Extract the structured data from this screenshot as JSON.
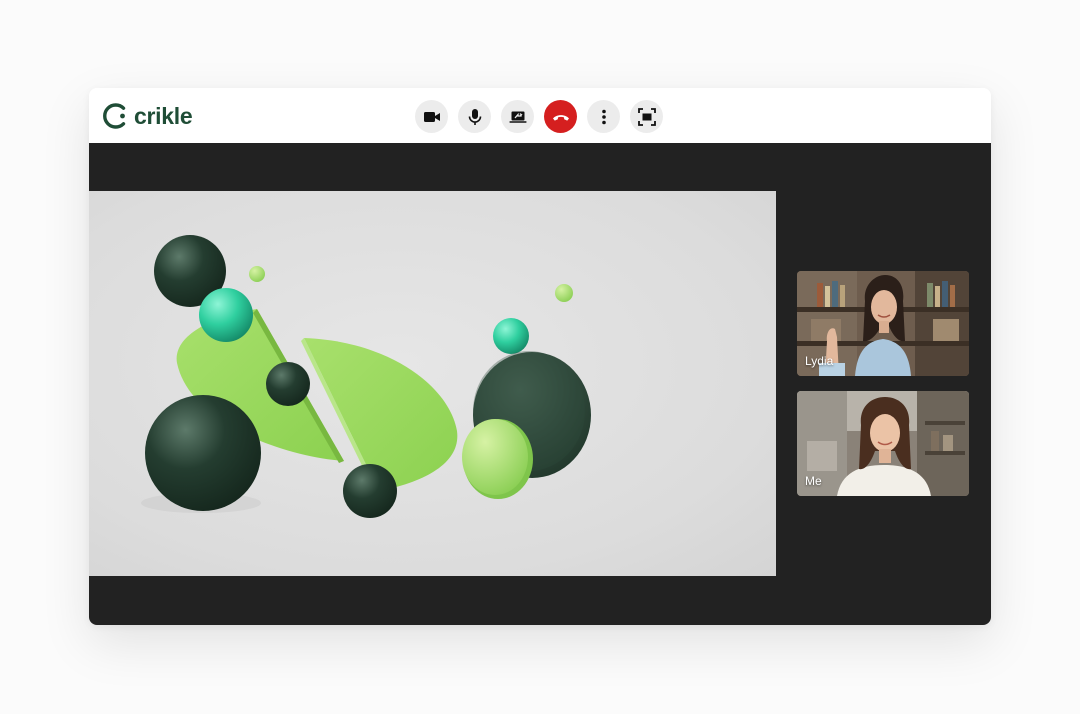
{
  "app": {
    "brand_name": "crikle",
    "brand_color": "#1f4d36"
  },
  "toolbar": {
    "buttons": [
      {
        "name": "camera",
        "icon": "video-camera-icon"
      },
      {
        "name": "microphone",
        "icon": "microphone-icon"
      },
      {
        "name": "share-screen",
        "icon": "present-screen-icon"
      },
      {
        "name": "end-call",
        "icon": "hang-up-icon",
        "color": "#d51f1f"
      },
      {
        "name": "more-options",
        "icon": "vertical-dots-icon"
      },
      {
        "name": "fullscreen",
        "icon": "fullscreen-frame-icon"
      }
    ]
  },
  "participants": [
    {
      "label": "Lydia"
    },
    {
      "label": "Me"
    }
  ],
  "shared_content": {
    "description_icon": "abstract-3d-shapes-image"
  }
}
